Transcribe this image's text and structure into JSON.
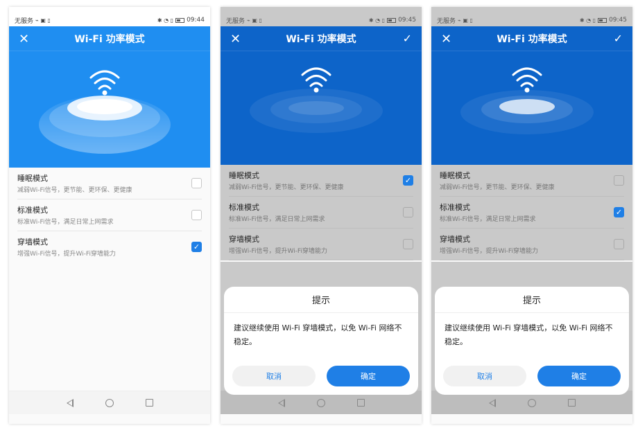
{
  "screens": [
    {
      "status": {
        "carrier": "无服务",
        "time": "09:44"
      },
      "title": "Wi-Fi 功率模式",
      "show_confirm_icon": false,
      "modes": [
        {
          "title": "睡眠模式",
          "desc": "减弱Wi-Fi信号，更节能、更环保、更健康",
          "checked": false
        },
        {
          "title": "标准模式",
          "desc": "标准Wi-Fi信号，满足日常上网需求",
          "checked": false
        },
        {
          "title": "穿墙模式",
          "desc": "增强Wi-Fi信号，提升Wi-Fi穿墙能力",
          "checked": true
        }
      ],
      "dialog": null
    },
    {
      "status": {
        "carrier": "无服务",
        "time": "09:45"
      },
      "title": "Wi-Fi 功率模式",
      "show_confirm_icon": true,
      "modes": [
        {
          "title": "睡眠模式",
          "desc": "减弱Wi-Fi信号，更节能、更环保、更健康",
          "checked": true
        },
        {
          "title": "标准模式",
          "desc": "标准Wi-Fi信号，满足日常上网需求",
          "checked": false
        },
        {
          "title": "穿墙模式",
          "desc": "增强Wi-Fi信号，提升Wi-Fi穿墙能力",
          "checked": false
        }
      ],
      "dialog": {
        "title": "提示",
        "message": "建议继续使用 Wi-Fi 穿墙模式，以免 Wi-Fi 网络不稳定。",
        "cancel": "取消",
        "ok": "确定"
      }
    },
    {
      "status": {
        "carrier": "无服务",
        "time": "09:45"
      },
      "title": "Wi-Fi 功率模式",
      "show_confirm_icon": true,
      "modes": [
        {
          "title": "睡眠模式",
          "desc": "减弱Wi-Fi信号，更节能、更环保、更健康",
          "checked": false
        },
        {
          "title": "标准模式",
          "desc": "标准Wi-Fi信号，满足日常上网需求",
          "checked": true
        },
        {
          "title": "穿墙模式",
          "desc": "增强Wi-Fi信号，提升Wi-Fi穿墙能力",
          "checked": false
        }
      ],
      "dialog": {
        "title": "提示",
        "message": "建议继续使用 Wi-Fi 穿墙模式，以免 Wi-Fi 网络不稳定。",
        "cancel": "取消",
        "ok": "确定"
      }
    }
  ],
  "icons": {
    "close": "close-icon",
    "confirm": "check-icon",
    "wifi": "wifi-icon",
    "checkbox_checked": "checkbox-checked-icon"
  },
  "colors": {
    "accent": "#1f7fe6",
    "banner": "#1f8ef1",
    "banner_dimmed": "#0d64c9"
  }
}
